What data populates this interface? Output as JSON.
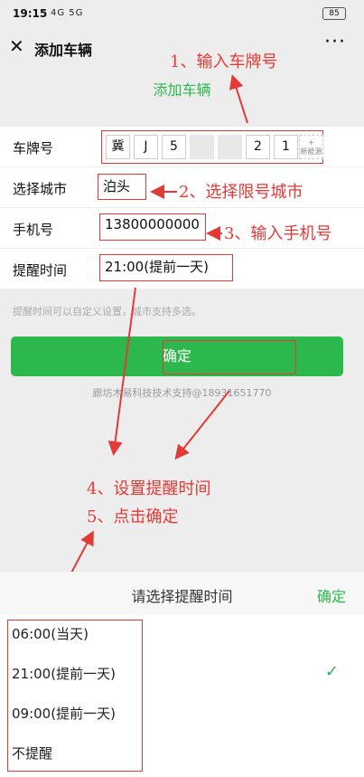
{
  "status": {
    "time": "19:15",
    "signal": "4G 5G",
    "battery": "85"
  },
  "nav": {
    "title": "添加车辆",
    "more": "···"
  },
  "page": {
    "heading": "添加车辆"
  },
  "form": {
    "plate_label": "车牌号",
    "plate_chars": [
      "冀",
      "J",
      "5",
      "",
      "",
      "2",
      "1"
    ],
    "plate_new_energy": "新能源",
    "city_label": "选择城市",
    "city_value": "泊头",
    "phone_label": "手机号",
    "phone_value": "13800000000",
    "remind_label": "提醒时间",
    "remind_value": "21:00(提前一天)",
    "hint": "提醒时间可以自定义设置，城市支持多选。",
    "confirm": "确定",
    "support": "廊坊木易科技技术支持@18931651770"
  },
  "annotations": {
    "step1": "1、输入车牌号",
    "step2": "2、选择限号城市",
    "step3": "3、输入手机号",
    "step4": "4、设置提醒时间",
    "step5": "5、点击确定"
  },
  "sheet": {
    "title": "请选择提醒时间",
    "confirm": "确定",
    "options": [
      "06:00(当天)",
      "21:00(提前一天)",
      "09:00(提前一天)",
      "不提醒"
    ],
    "selected_index": 1,
    "check": "✓"
  },
  "colors": {
    "accent": "#2db84d",
    "annotation": "#e53935"
  }
}
